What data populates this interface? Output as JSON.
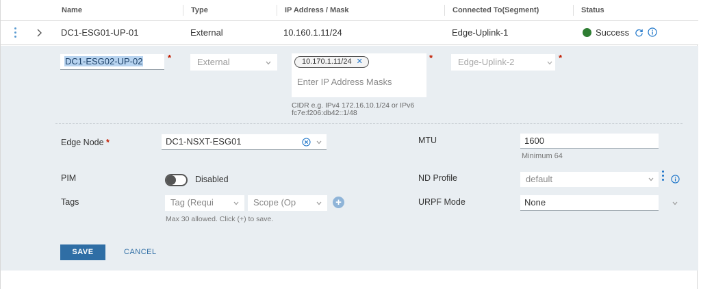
{
  "table": {
    "columns": [
      "Name",
      "Type",
      "IP Address / Mask",
      "Connected To(Segment)",
      "Status"
    ],
    "row": {
      "name": "DC1-ESG01-UP-01",
      "type": "External",
      "ip": "10.160.1.11/24",
      "segment": "Edge-Uplink-1",
      "status": "Success",
      "status_color": "#2e7d32"
    }
  },
  "edit": {
    "name_value": "DC1-ESG02-UP-02",
    "type_value": "External",
    "ip_chip": "10.170.1.11/24",
    "ip_placeholder": "Enter IP Address Masks",
    "ip_hint_line1": "CIDR e.g. IPv4 172.16.10.1/24 or IPv6",
    "ip_hint_line2": "fc7e:f206:db42::1/48",
    "segment_value": "Edge-Uplink-2",
    "edge_node_label": "Edge Node",
    "edge_node_value": "DC1-NSXT-ESG01",
    "mtu_label": "MTU",
    "mtu_value": "1600",
    "mtu_hint": "Minimum 64",
    "pim_label": "PIM",
    "pim_state": "Disabled",
    "nd_profile_label": "ND Profile",
    "nd_profile_value": "default",
    "tags_label": "Tags",
    "tag_placeholder": "Tag (Requi",
    "scope_placeholder": "Scope (Op",
    "tags_hint": "Max 30 allowed. Click (+) to save.",
    "urpf_label": "URPF Mode",
    "urpf_value": "None",
    "save_label": "SAVE",
    "cancel_label": "CANCEL"
  },
  "icons": {
    "row_actions": "kebab-icon",
    "expand": "chevron-right-icon",
    "refresh": "refresh-icon",
    "info": "info-icon",
    "clear": "clear-icon",
    "add": "plus-circle-icon"
  },
  "colors": {
    "accent": "#2f6ea5",
    "required": "#c21d00",
    "panel_bg": "#e9eef2",
    "success": "#2e7d32"
  }
}
